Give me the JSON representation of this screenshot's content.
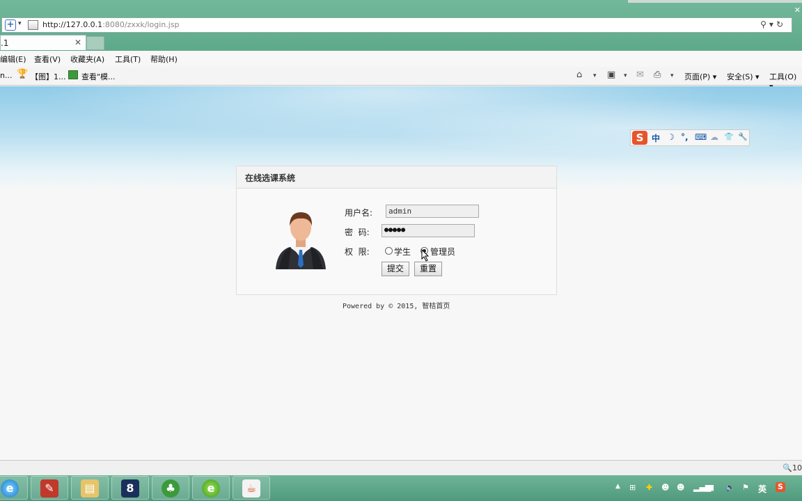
{
  "browser": {
    "url_host": "http://127.0.0.1",
    "url_rest": ":8080/zxxk/login.jsp",
    "tab_title": ".1",
    "menu": [
      "编辑(E)",
      "查看(V)",
      "收藏夹(A)",
      "工具(T)",
      "帮助(H)"
    ],
    "favorites": [
      "n...",
      "【图】1...",
      "查看\"模..."
    ],
    "commands": [
      "页面(P) ▾",
      "安全(S) ▾",
      "工具(O) ▾"
    ],
    "zoom": "10"
  },
  "ime": {
    "logo": "S",
    "items": [
      "中",
      "☽",
      "°,",
      "⌨",
      "☁",
      "👕",
      "🔧"
    ]
  },
  "login": {
    "title": "在线选课系统",
    "username_label": "用户名:",
    "username_value": "admin",
    "password_label": "密  码:",
    "password_value": "●●●●●",
    "role_label": "权  限:",
    "role_student": "学生",
    "role_admin": "管理员",
    "selected_role": "admin",
    "submit_label": "提交",
    "reset_label": "重置"
  },
  "footer": {
    "text": "Powered by © 2015, 智桔首页"
  },
  "taskbar": {
    "tray_lang": "英"
  }
}
